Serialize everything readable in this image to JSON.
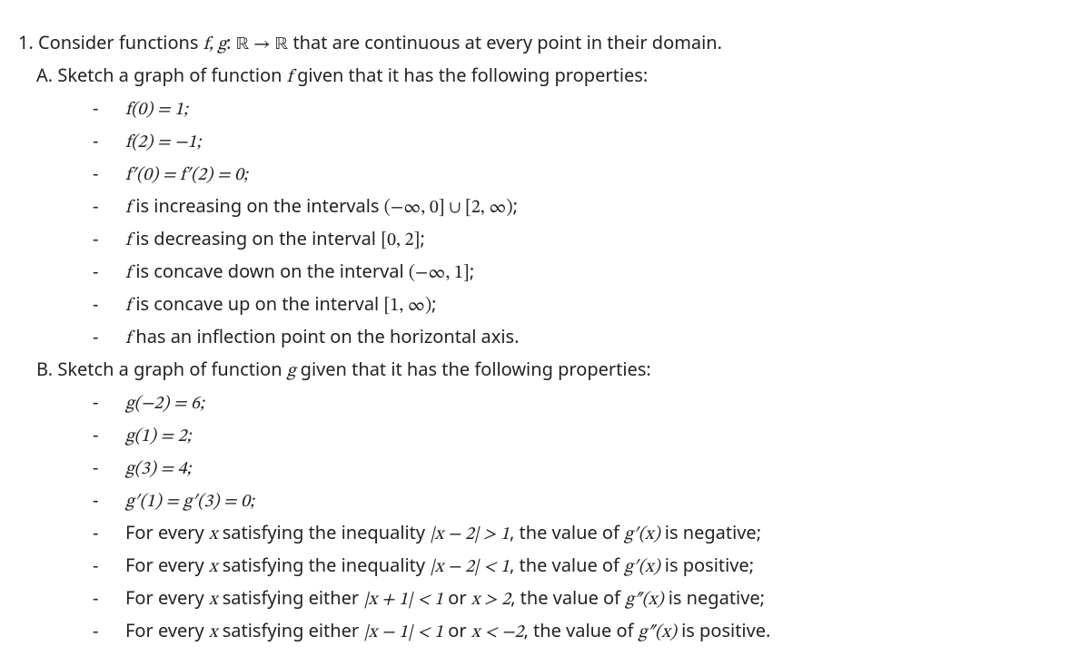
{
  "q1": {
    "intro_pre": "1. Consider functions ",
    "intro_fg": "f, g",
    "intro_colon": ": ",
    "intro_R1": "ℝ",
    "intro_arrow": " → ",
    "intro_R2": "ℝ",
    "intro_post": " that are continuous at every point in their domain.",
    "A": {
      "lead_pre": "A. Sketch a graph of function ",
      "lead_f": "f",
      "lead_post": " given that it has the following properties:",
      "items": [
        {
          "expr": "f(0) = 1;"
        },
        {
          "expr": "f(2) = −1;"
        },
        {
          "expr": "f′(0) = f′(2) = 0;"
        },
        {
          "pre": "",
          "f": "f",
          "mid": " is increasing on the intervals ",
          "expr": "(−∞, 0] ∪ [2, ∞)",
          "post": ";"
        },
        {
          "pre": "",
          "f": "f",
          "mid": " is decreasing on the interval ",
          "expr": "[0, 2]",
          "post": ";"
        },
        {
          "pre": "",
          "f": "f",
          "mid": " is concave down on the interval ",
          "expr": "(−∞, 1]",
          "post": ";"
        },
        {
          "pre": "",
          "f": "f",
          "mid": " is concave up on the interval ",
          "expr": "[1, ∞)",
          "post": ";"
        },
        {
          "pre": "",
          "f": "f",
          "mid": " has an inflection point on the horizontal axis.",
          "expr": "",
          "post": ""
        }
      ]
    },
    "B": {
      "lead_pre": "B. Sketch a graph of function ",
      "lead_g": "g",
      "lead_post": " given that it has the following properties:",
      "items": [
        {
          "expr": "g(−2) = 6;"
        },
        {
          "expr": "g(1) = 2;"
        },
        {
          "expr": "g(3) = 4;"
        },
        {
          "expr": "g′(1) = g′(3) = 0;"
        },
        {
          "pre": "For every ",
          "x": "x",
          "mid": " satisfying the inequality ",
          "expr": "|x − 2| > 1",
          "mid2": ", the value of ",
          "fn": "g′(x)",
          "post": " is negative;"
        },
        {
          "pre": "For every ",
          "x": "x",
          "mid": " satisfying the inequality ",
          "expr": "|x − 2| < 1",
          "mid2": ", the value of ",
          "fn": "g′(x)",
          "post": " is positive;"
        },
        {
          "pre": "For every ",
          "x": "x",
          "mid": " satisfying either ",
          "expr": "|x + 1| < 1",
          "or": " or ",
          "expr2": "x > 2",
          "mid2": ", the value of ",
          "fn": "g″(x)",
          "post": " is negative;"
        },
        {
          "pre": "For every ",
          "x": "x",
          "mid": " satisfying either ",
          "expr": "|x − 1| < 1",
          "or": " or ",
          "expr2": "x < −2",
          "mid2": ", the value of ",
          "fn": "g″(x)",
          "post": " is positive."
        }
      ]
    }
  }
}
